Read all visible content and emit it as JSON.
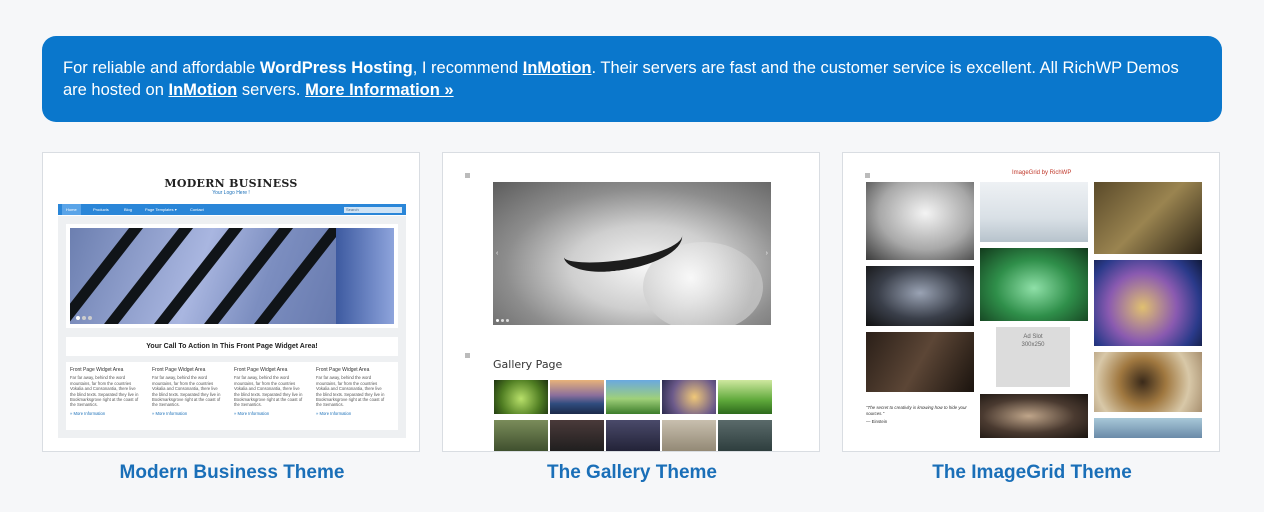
{
  "banner": {
    "text1": "For reliable and affordable ",
    "strong1": "WordPress Hosting",
    "text2": ", I recommend ",
    "link1": "InMotion",
    "text3": ". Their servers are fast and the customer service is excellent. All RichWP Demos are hosted on ",
    "link2": "InMotion",
    "text4": " servers. ",
    "link3": "More Information »"
  },
  "themes": [
    {
      "caption": "Modern Business Theme",
      "preview": {
        "site_title": "MODERN BUSINESS",
        "site_sub": "Your Logo Here !",
        "nav": [
          "Home",
          "Products",
          "Blog",
          "Page Templates ▾",
          "Contact"
        ],
        "search": "Search",
        "cta": "Your Call To Action In This Front Page Widget Area!",
        "widget_title": "Front Page Widget Area",
        "widget_text": "Far far away, behind the word mountains, far from the countries Vokalia and Consonantia, there live the blind texts. Separated they live in Bookmarksgrove right at the coast of the Semantics.",
        "widget_link": "» More Information"
      }
    },
    {
      "caption": "The Gallery Theme",
      "preview": {
        "section_title": "Gallery Page"
      }
    },
    {
      "caption": "The ImageGrid Theme",
      "preview": {
        "logo": "ImageGrid by RichWP",
        "ad_title": "Ad Slot",
        "ad_size": "300x250",
        "quote": "\"The secret to creativity is knowing how to hide your sources.\"",
        "quote_author": "— Einstein"
      }
    }
  ],
  "colors": {
    "banner_bg": "#0a77cc",
    "caption": "#1a6fb8",
    "page_bg": "#f6f7f9"
  }
}
